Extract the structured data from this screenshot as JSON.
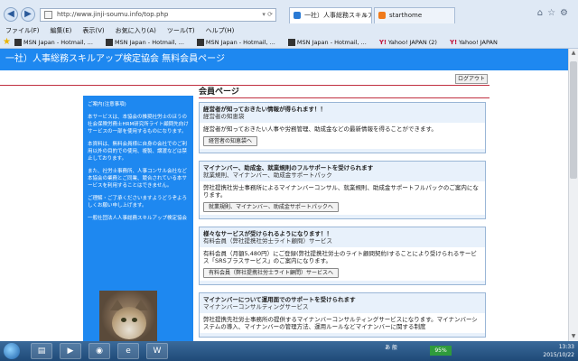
{
  "browser": {
    "address": "http://www.jinji-soumu.info/top.php",
    "tabs": [
      {
        "label": "一社）人事総務スキルアップ...",
        "active": true
      },
      {
        "label": "starthome",
        "active": false
      }
    ],
    "menu": [
      "ファイル(F)",
      "編集(E)",
      "表示(V)",
      "お気に入り(A)",
      "ツール(T)",
      "ヘルプ(H)"
    ],
    "favorites": [
      {
        "label": "MSN Japan - Hotmail, ...",
        "icon": "msn-icon"
      },
      {
        "label": "MSN Japan - Hotmail, ...",
        "icon": "msn-icon"
      },
      {
        "label": "MSN Japan - Hotmail, ...",
        "icon": "msn-icon"
      },
      {
        "label": "MSN Japan - Hotmail, ...",
        "icon": "msn-icon"
      },
      {
        "label": "Yahoo! JAPAN (2)",
        "icon": "yahoo-icon"
      },
      {
        "label": "Yahoo! JAPAN",
        "icon": "yahoo-icon"
      }
    ]
  },
  "site": {
    "banner": "一社）人事総務スキルアップ検定協会 無料会員ページ",
    "logout": "ログアウト",
    "page_title": "会員ページ",
    "sidebar": {
      "heading": "ご案内(注意事項)",
      "p1": "本サービスは、本協会の推奨社労士のほうの社会保険労務士HRM研究所ライト顧問先向けサービスの一部を使用するものになります。",
      "p2": "本資料は、無料会員様に自身の会社でのご利用以外の目的での使用、複製、譲渡などは禁止しております。",
      "p3": "また、社労士事務所、人事コンサル会社など本協会の業務とご同業、競合されている本サービスを利用することはできません。",
      "p4": "ご理解・ご了承くださいますようどうぞよろしくお願い申し上げます。",
      "sign": "一般社団法人人事総務スキルアップ検定協会"
    },
    "cards": [
      {
        "title": "経営者が知っておきたい情報が得られます！！",
        "subtitle": "経営者の知恵袋",
        "body": "経営者が知っておきたい人事や労務管理、助成金などの最新情報を得ることができます。",
        "button": "経営者の知恵袋へ"
      },
      {
        "title": "マイナンバー、助成金、就業規則のフルサポートを受けられます",
        "subtitle": "就業規則、マイナンバー、助成金サポートパック",
        "body": "弊社提携社労士事務所によるマイナンバーコンサル、就業規則、助成金サポートフルパックのご案内になります。",
        "button": "就業規則、マイナンバー、助成金サポートパックへ"
      },
      {
        "title": "様々なサービスが受けられるようになります！！",
        "subtitle": "有料会員（弊社提携社労士ライト顧問）サービス",
        "body": "有料会員（月額5,480円）にご登録(弊社提携社労士のライト顧問契約)することにより受けられるサービス「SRSプラスサービス」のご案内になります。",
        "button": "有料会員（弊社提携社労士ライト顧問）サービスへ"
      },
      {
        "title": "マイナンバーについて運用面でのサポートを受けられます",
        "subtitle": "マイナンバーコンサルティングサービス",
        "body": "弊社提携先社労士事務所の提供するマイナンバーコンサルティングサービスになります。マイナンバーシステムの導入、マイナンバーの管理方法、運用ルールなどマイナンバーに関する制度",
        "button": ""
      }
    ]
  },
  "taskbar": {
    "apps": [
      "explorer-icon",
      "media-icon",
      "chrome-icon",
      "ie-icon",
      "word-icon"
    ],
    "battery": "95%",
    "time": "13:33",
    "date": "2015/10/22",
    "lang": "あ 般"
  }
}
